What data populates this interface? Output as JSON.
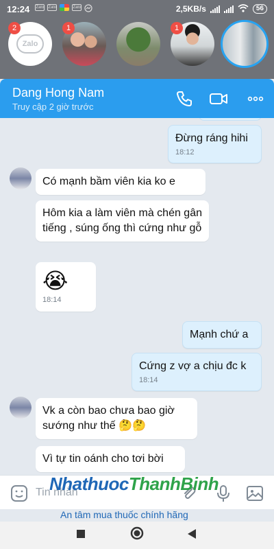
{
  "status_bar": {
    "time": "12:24",
    "notif_icons": [
      "Zalo",
      "Zalo",
      "pinwheel",
      "Zalo",
      "messenger"
    ],
    "net_speed": "2,5KB/s",
    "battery": "56"
  },
  "chat_heads": [
    {
      "name": "Zalo",
      "badge": "2"
    },
    {
      "badge": "1"
    },
    {
      "badge": ""
    },
    {
      "badge": "1"
    },
    {
      "badge": "",
      "active": true
    }
  ],
  "header": {
    "contact_name": "Dang Hong Nam",
    "contact_status": "Truy cập 2 giờ trước",
    "bg_color": "#2b9dee"
  },
  "messages": [
    {
      "dir": "out",
      "text": "Đừng ráng hihi",
      "time": "18:12"
    },
    {
      "dir": "in",
      "text": "Có mạnh bầm viên kia ko e",
      "time": ""
    },
    {
      "dir": "in",
      "text": "Hôm kia a làm viên mà chén gân tiếng , súng ống thì cứng như gỗ",
      "time": ""
    },
    {
      "dir": "in",
      "emoji": "😭",
      "time": "18:14"
    },
    {
      "dir": "out",
      "text": "Mạnh chứ a",
      "time": ""
    },
    {
      "dir": "out",
      "text": "Cứng z vợ a chịu đc k",
      "time": "18:14"
    },
    {
      "dir": "in",
      "text": "Vk a còn bao chưa bao giờ sướng như thế 🤔🤔",
      "time": ""
    },
    {
      "dir": "in",
      "text": "Vì tự tin oánh cho tơi bời",
      "time": ""
    }
  ],
  "input": {
    "placeholder": "Tin nhắn"
  },
  "watermark": {
    "brand_part1": "Nhathuoc",
    "brand_part2": "ThanhBinh",
    "tagline": "An tâm mua thuốc chính hãng"
  }
}
